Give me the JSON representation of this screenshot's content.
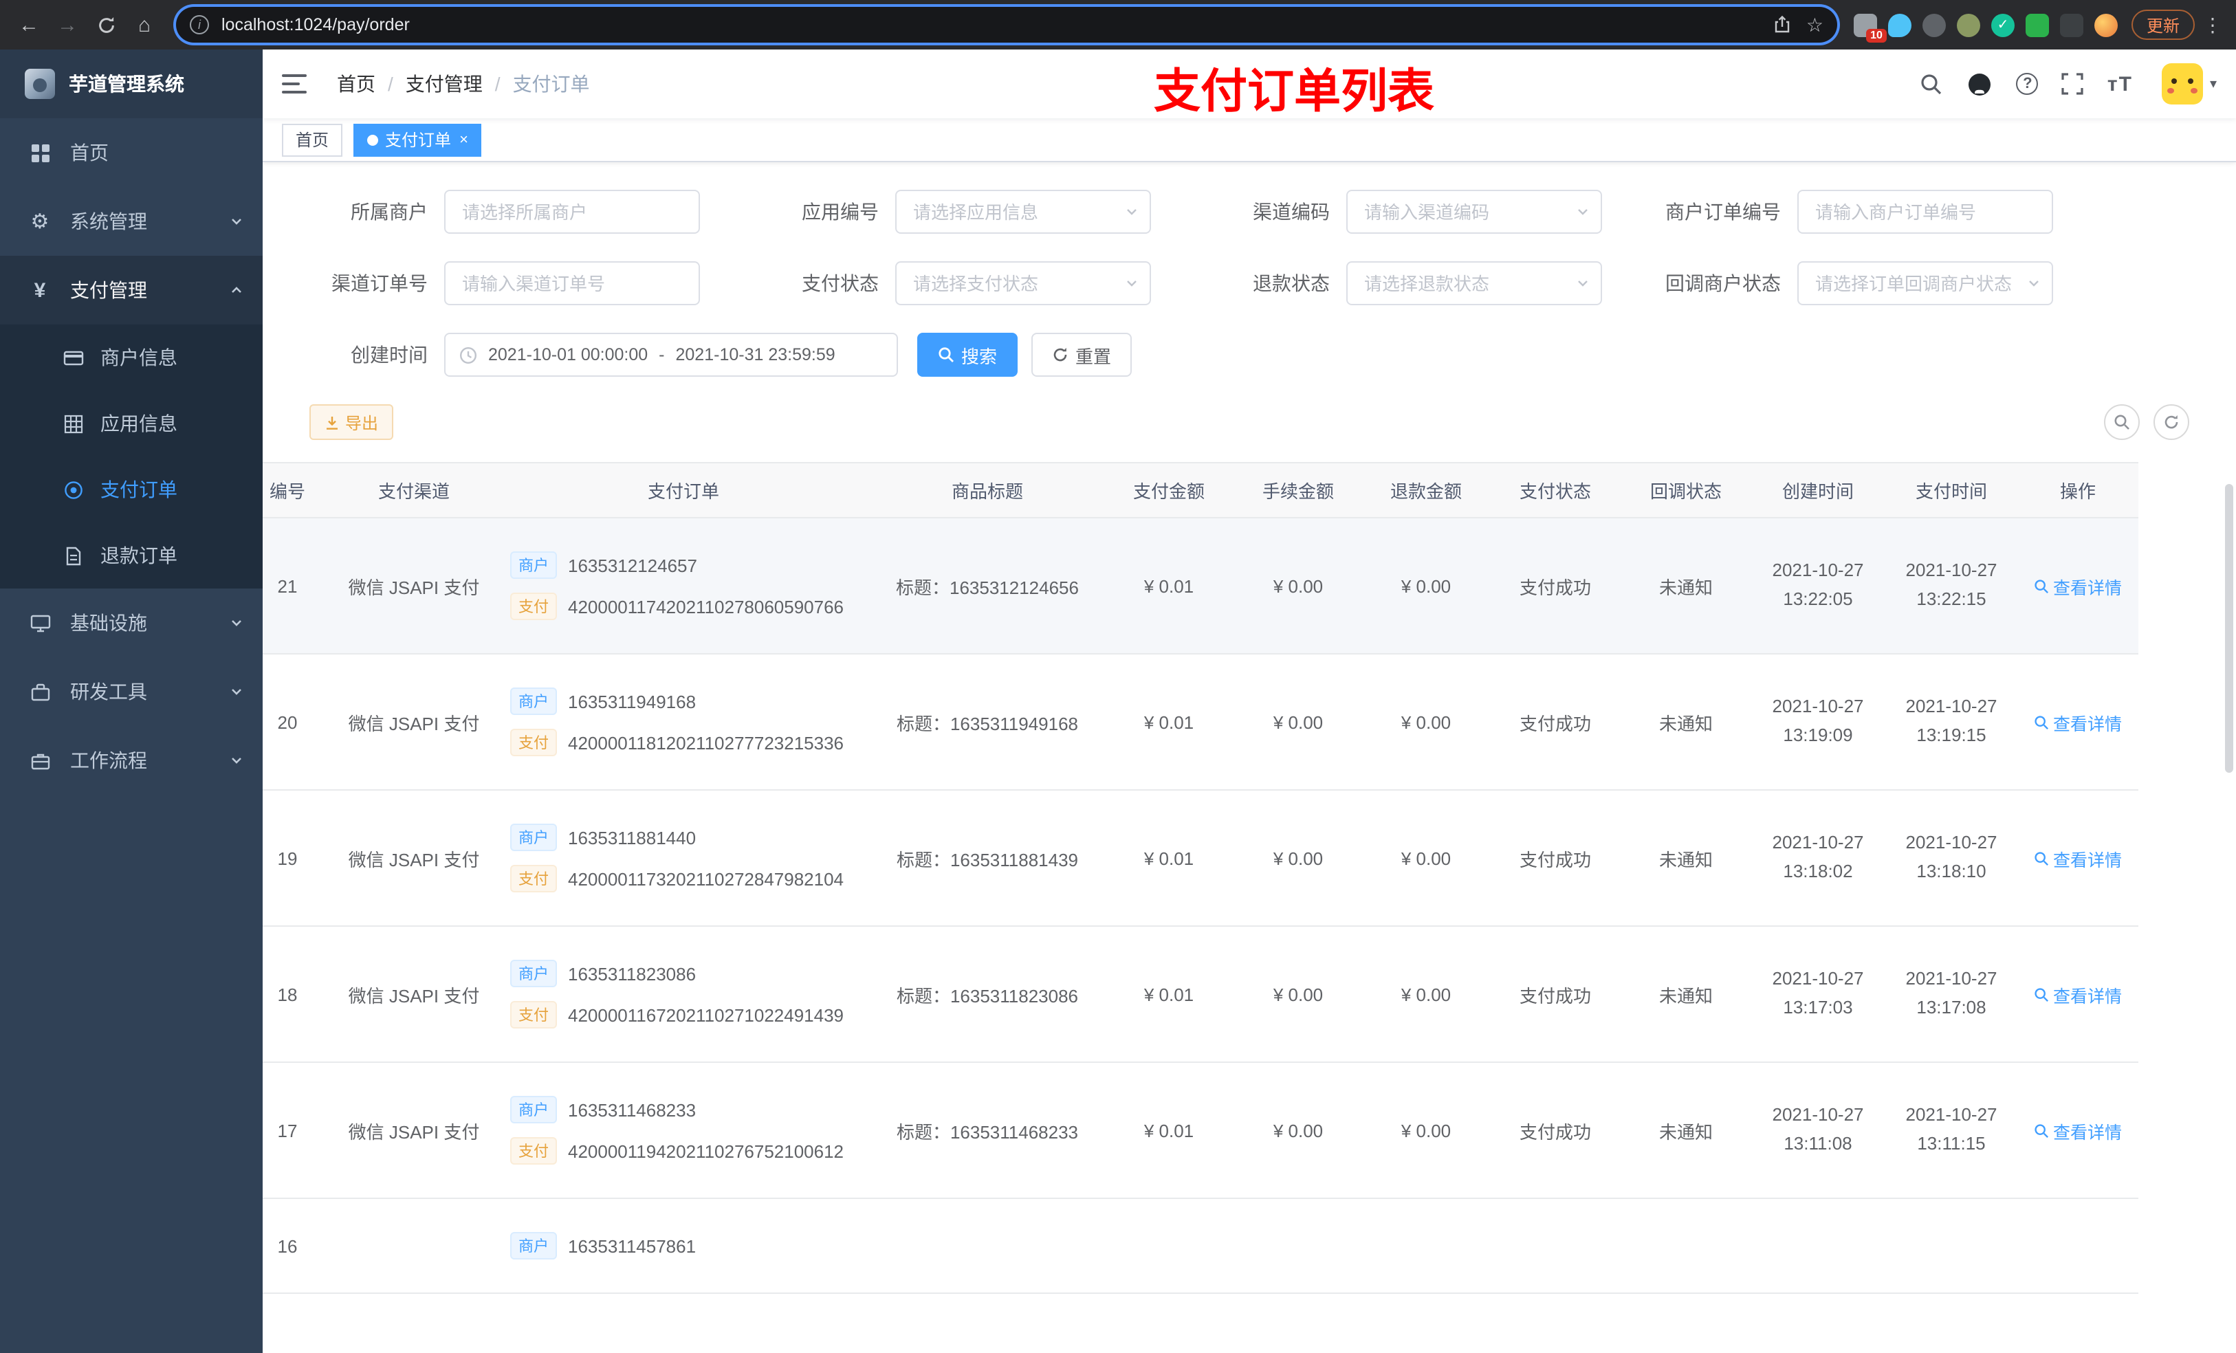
{
  "browser": {
    "url": "localhost:1024/pay/order",
    "update_label": "更新",
    "extension_badge": "10"
  },
  "sidebar": {
    "title": "芋道管理系统",
    "items": [
      {
        "label": "首页"
      },
      {
        "label": "系统管理"
      },
      {
        "label": "支付管理"
      },
      {
        "label": "基础设施"
      },
      {
        "label": "研发工具"
      },
      {
        "label": "工作流程"
      }
    ],
    "submenu": [
      {
        "label": "商户信息"
      },
      {
        "label": "应用信息"
      },
      {
        "label": "支付订单"
      },
      {
        "label": "退款订单"
      }
    ]
  },
  "navbar": {
    "breadcrumb": [
      "首页",
      "支付管理",
      "支付订单"
    ],
    "separator": "/",
    "annotation": "支付订单列表"
  },
  "tags": {
    "home": "首页",
    "active": "支付订单",
    "close": "×"
  },
  "filters": {
    "row1": [
      {
        "label": "所属商户",
        "placeholder": "请选择所属商户"
      },
      {
        "label": "应用编号",
        "placeholder": "请选择应用信息"
      },
      {
        "label": "渠道编码",
        "placeholder": "请输入渠道编码"
      },
      {
        "label": "商户订单编号",
        "placeholder": "请输入商户订单编号"
      }
    ],
    "row2": [
      {
        "label": "渠道订单号",
        "placeholder": "请输入渠道订单号"
      },
      {
        "label": "支付状态",
        "placeholder": "请选择支付状态"
      },
      {
        "label": "退款状态",
        "placeholder": "请选择退款状态"
      },
      {
        "label": "回调商户状态",
        "placeholder": "请选择订单回调商户状态"
      }
    ],
    "create_time_label": "创建时间",
    "date_start": "2021-10-01 00:00:00",
    "date_separator": "-",
    "date_end": "2021-10-31 23:59:59",
    "search_label": "搜索",
    "reset_label": "重置"
  },
  "toolbar": {
    "export_label": "导出"
  },
  "table": {
    "columns": [
      "编号",
      "支付渠道",
      "支付订单",
      "商品标题",
      "支付金额",
      "手续金额",
      "退款金额",
      "支付状态",
      "回调状态",
      "创建时间",
      "支付时间",
      "操作"
    ],
    "merchant_tag": "商户",
    "pay_tag": "支付",
    "action_label": "查看详情",
    "rows": [
      {
        "id": "21",
        "channel": "微信 JSAPI 支付",
        "merchant_no": "1635312124657",
        "pay_no": "4200001174202110278060590766",
        "title": "标题：1635312124656",
        "amount": "¥ 0.01",
        "fee": "¥ 0.00",
        "refund": "¥ 0.00",
        "status": "支付成功",
        "notify": "未通知",
        "create_time": "2021-10-27 13:22:05",
        "pay_time": "2021-10-27 13:22:15"
      },
      {
        "id": "20",
        "channel": "微信 JSAPI 支付",
        "merchant_no": "1635311949168",
        "pay_no": "4200001181202110277723215336",
        "title": "标题：1635311949168",
        "amount": "¥ 0.01",
        "fee": "¥ 0.00",
        "refund": "¥ 0.00",
        "status": "支付成功",
        "notify": "未通知",
        "create_time": "2021-10-27 13:19:09",
        "pay_time": "2021-10-27 13:19:15"
      },
      {
        "id": "19",
        "channel": "微信 JSAPI 支付",
        "merchant_no": "1635311881440",
        "pay_no": "4200001173202110272847982104",
        "title": "标题：1635311881439",
        "amount": "¥ 0.01",
        "fee": "¥ 0.00",
        "refund": "¥ 0.00",
        "status": "支付成功",
        "notify": "未通知",
        "create_time": "2021-10-27 13:18:02",
        "pay_time": "2021-10-27 13:18:10"
      },
      {
        "id": "18",
        "channel": "微信 JSAPI 支付",
        "merchant_no": "1635311823086",
        "pay_no": "4200001167202110271022491439",
        "title": "标题：1635311823086",
        "amount": "¥ 0.01",
        "fee": "¥ 0.00",
        "refund": "¥ 0.00",
        "status": "支付成功",
        "notify": "未通知",
        "create_time": "2021-10-27 13:17:03",
        "pay_time": "2021-10-27 13:17:08"
      },
      {
        "id": "17",
        "channel": "微信 JSAPI 支付",
        "merchant_no": "1635311468233",
        "pay_no": "4200001194202110276752100612",
        "title": "标题：1635311468233",
        "amount": "¥ 0.01",
        "fee": "¥ 0.00",
        "refund": "¥ 0.00",
        "status": "支付成功",
        "notify": "未通知",
        "create_time": "2021-10-27 13:11:08",
        "pay_time": "2021-10-27 13:11:15"
      },
      {
        "id": "16",
        "channel": "",
        "merchant_no": "1635311457861",
        "pay_no": "",
        "title": "",
        "amount": "",
        "fee": "",
        "refund": "",
        "status": "",
        "notify": "",
        "create_time": "",
        "pay_time": ""
      }
    ]
  }
}
